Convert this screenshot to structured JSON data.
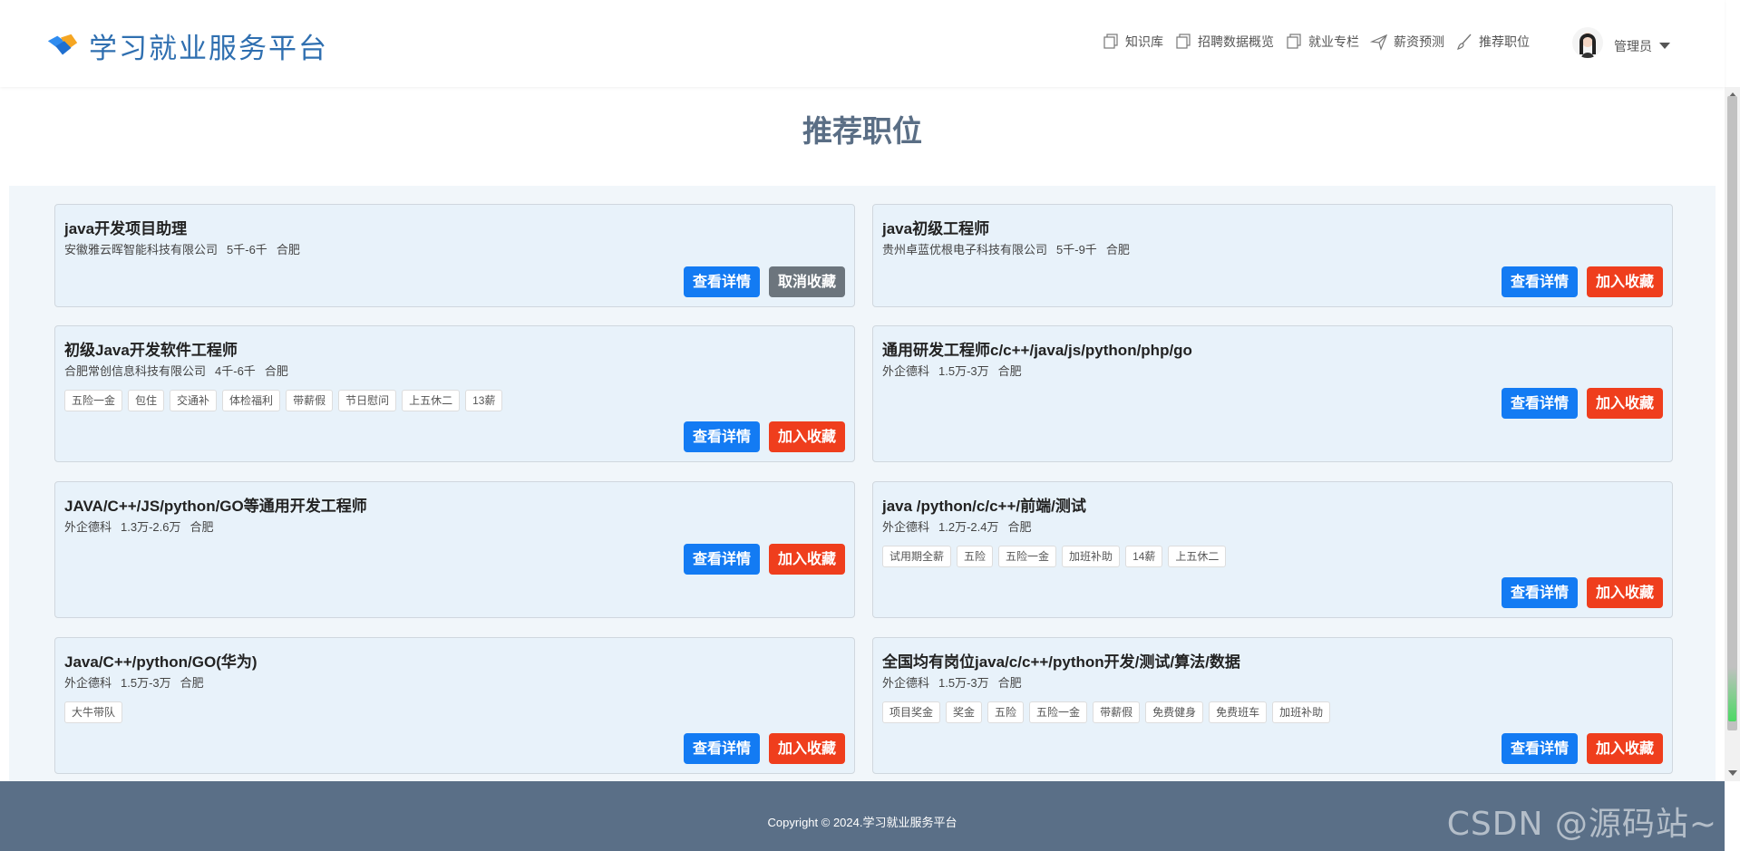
{
  "header": {
    "site_title": "学习就业服务平台",
    "nav": [
      {
        "label": "知识库",
        "icon": "copy-icon"
      },
      {
        "label": "招聘数据概览",
        "icon": "copy-icon"
      },
      {
        "label": "就业专栏",
        "icon": "copy-icon"
      },
      {
        "label": "薪资预测",
        "icon": "paper-plane-icon"
      },
      {
        "label": "推荐职位",
        "icon": "brush-icon"
      }
    ],
    "user_name": "管理员"
  },
  "page_title": "推荐职位",
  "jobs": [
    {
      "title": "java开发项目助理",
      "company": "安徽雅云晖智能科技有限公司",
      "salary": "5千-6千",
      "city": "合肥",
      "tags": [],
      "detail_label": "查看详情",
      "fav_label": "取消收藏"
    },
    {
      "title": "java初级工程师",
      "company": "贵州卓蓝优根电子科技有限公司",
      "salary": "5千-9千",
      "city": "合肥",
      "tags": [],
      "detail_label": "查看详情",
      "fav_label": "加入收藏"
    },
    {
      "title": "初级Java开发软件工程师",
      "company": "合肥常创信息科技有限公司",
      "salary": "4千-6千",
      "city": "合肥",
      "tags": [
        "五险一金",
        "包住",
        "交通补",
        "体检福利",
        "带薪假",
        "节日慰问",
        "上五休二",
        "13薪"
      ],
      "detail_label": "查看详情",
      "fav_label": "加入收藏"
    },
    {
      "title": "通用研发工程师c/c++/java/js/python/php/go",
      "company": "外企德科",
      "salary": "1.5万-3万",
      "city": "合肥",
      "tags": [],
      "detail_label": "查看详情",
      "fav_label": "加入收藏"
    },
    {
      "title": "JAVA/C++/JS/python/GO等通用开发工程师",
      "company": "外企德科",
      "salary": "1.3万-2.6万",
      "city": "合肥",
      "tags": [],
      "detail_label": "查看详情",
      "fav_label": "加入收藏"
    },
    {
      "title": "java /python/c/c++/前端/测试",
      "company": "外企德科",
      "salary": "1.2万-2.4万",
      "city": "合肥",
      "tags": [
        "试用期全薪",
        "五险",
        "五险一金",
        "加班补助",
        "14薪",
        "上五休二"
      ],
      "detail_label": "查看详情",
      "fav_label": "加入收藏"
    },
    {
      "title": "Java/C++/python/GO(华为)",
      "company": "外企德科",
      "salary": "1.5万-3万",
      "city": "合肥",
      "tags": [
        "大牛带队"
      ],
      "detail_label": "查看详情",
      "fav_label": "加入收藏"
    },
    {
      "title": "全国均有岗位java/c/c++/python开发/测试/算法/数据",
      "company": "外企德科",
      "salary": "1.5万-3万",
      "city": "合肥",
      "tags": [
        "项目奖金",
        "奖金",
        "五险",
        "五险一金",
        "带薪假",
        "免费健身",
        "免费班车",
        "加班补助"
      ],
      "detail_label": "查看详情",
      "fav_label": "加入收藏"
    }
  ],
  "footer": {
    "copyright": "Copyright © 2024.学习就业服务平台",
    "watermark": "CSDN @源码站~"
  },
  "colors": {
    "brand": "#2f6fb0",
    "primary_button": "#137bf3",
    "danger_button": "#ef3e1d",
    "secondary_button": "#6c757d",
    "footer_bg": "#5a6f87"
  }
}
